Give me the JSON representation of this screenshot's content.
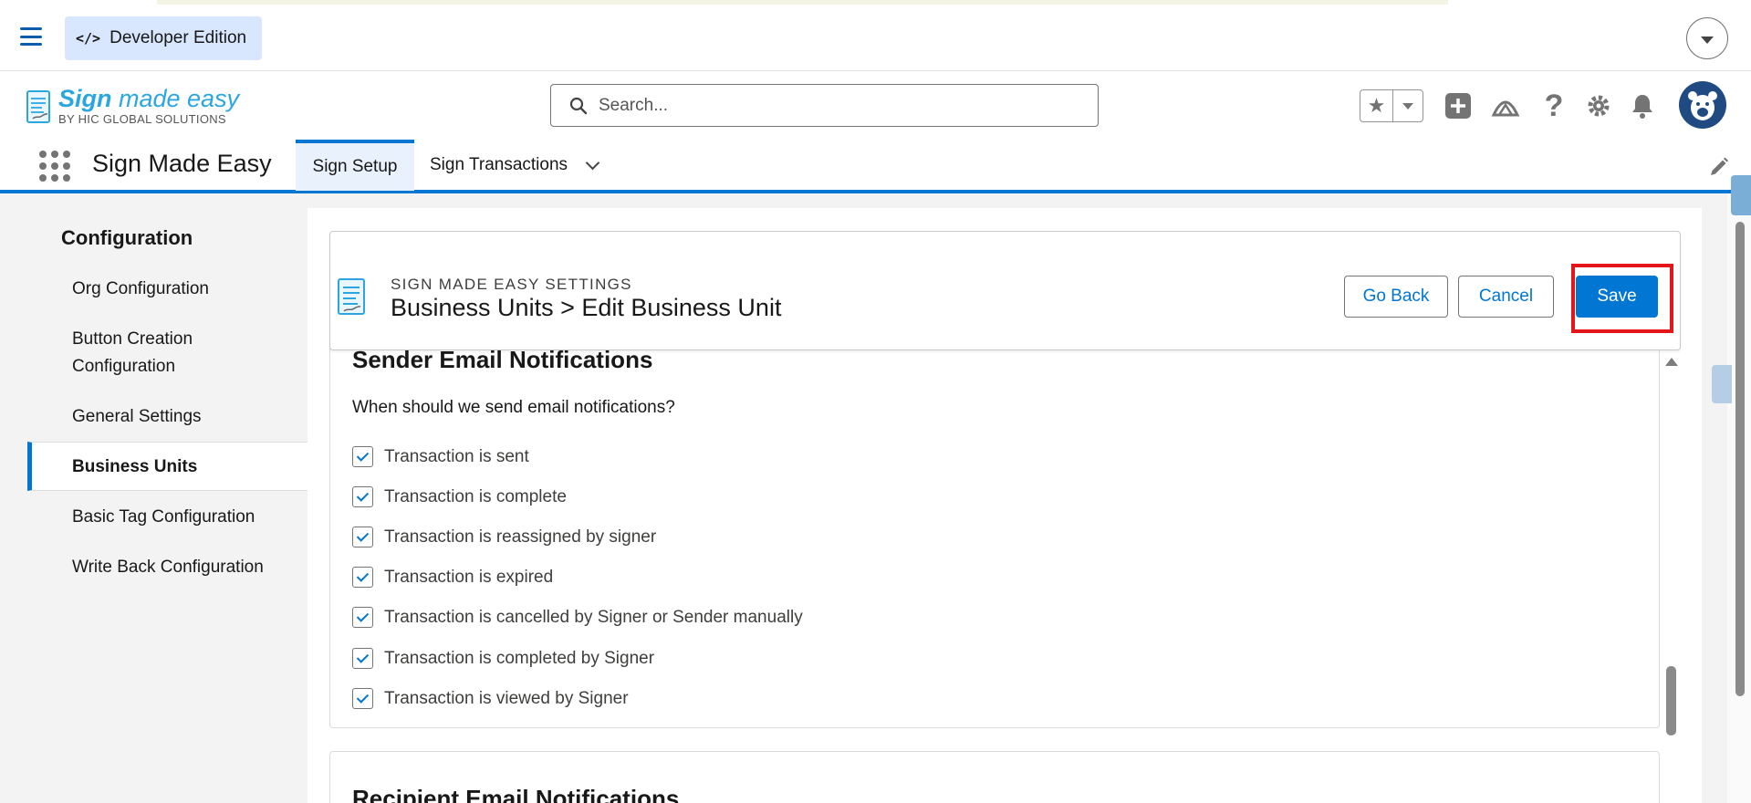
{
  "devbar": {
    "code_icon": "</>",
    "edition_label": "Developer Edition",
    "menu_icon": "hamburger-icon",
    "dropdown_icon": "chevron-down-icon"
  },
  "header": {
    "logo_main_bold": "Sign",
    "logo_main_rest": " made easy",
    "logo_sub": "BY HIC GLOBAL SOLUTIONS",
    "search_placeholder": "Search...",
    "icons": [
      "star-icon",
      "add-icon",
      "trailhead-icon",
      "help-icon",
      "setup-gear-icon",
      "bell-icon",
      "avatar"
    ]
  },
  "appnav": {
    "app_name": "Sign Made Easy",
    "tabs": [
      {
        "label": "Sign Setup",
        "active": true
      },
      {
        "label": "Sign Transactions",
        "active": false
      }
    ]
  },
  "sidebar": {
    "heading": "Configuration",
    "items": [
      {
        "label": "Org Configuration"
      },
      {
        "label": "Button Creation Configuration"
      },
      {
        "label": "General Settings"
      },
      {
        "label": "Business Units",
        "active": true
      },
      {
        "label": "Basic Tag Configuration"
      },
      {
        "label": "Write Back Configuration"
      }
    ]
  },
  "page_header": {
    "eyebrow": "SIGN MADE EASY SETTINGS",
    "title": "Business Units > Edit Business Unit",
    "buttons": {
      "go_back": "Go Back",
      "cancel": "Cancel",
      "save": "Save"
    }
  },
  "sender": {
    "title": "Sender Email Notifications",
    "question": "When should we send email notifications?",
    "options": [
      {
        "label": "Transaction is sent",
        "checked": true
      },
      {
        "label": "Transaction is complete",
        "checked": true
      },
      {
        "label": "Transaction is reassigned by signer",
        "checked": true
      },
      {
        "label": "Transaction is expired",
        "checked": true
      },
      {
        "label": "Transaction is cancelled by Signer or Sender manually",
        "checked": true
      },
      {
        "label": "Transaction is completed by Signer",
        "checked": true
      },
      {
        "label": "Transaction is viewed by Signer",
        "checked": true
      }
    ]
  },
  "recipient": {
    "title": "Recipient Email Notifications"
  },
  "colors": {
    "brand": "#0176d3",
    "highlight": "#e5161b",
    "logo": "#2ba6e0"
  }
}
